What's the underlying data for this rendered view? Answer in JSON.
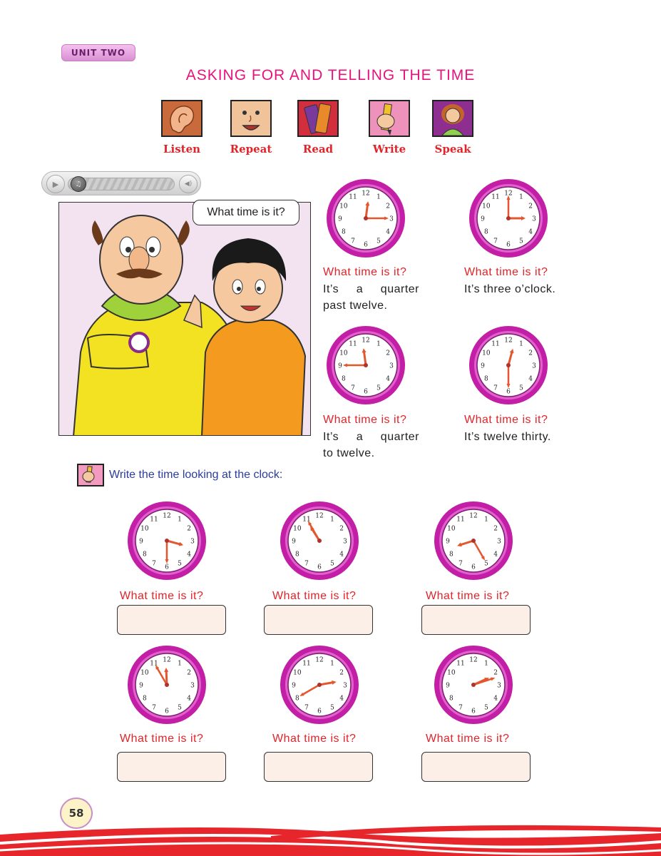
{
  "header": {
    "unit_label": "UNIT TWO",
    "title": "ASKING FOR AND TELLING THE TIME"
  },
  "skills": [
    {
      "label": "Listen",
      "icon": "ear-icon"
    },
    {
      "label": "Repeat",
      "icon": "talking-face-icon"
    },
    {
      "label": "Read",
      "icon": "books-icon"
    },
    {
      "label": "Write",
      "icon": "pencil-hand-icon"
    },
    {
      "label": "Speak",
      "icon": "girl-speaking-icon"
    }
  ],
  "audio_player": {
    "play_icon": "▶",
    "knob_icon": "♫",
    "volume_icon": "◀)"
  },
  "dialogue": {
    "bubble": "What time is it?"
  },
  "examples": [
    {
      "question": "What time is it?",
      "answer_line1": "It’s a quarter",
      "answer_line2": "past twelve.",
      "time": "12:15"
    },
    {
      "question": "What time is it?",
      "answer_line1": "It’s three o’clock.",
      "answer_line2": "",
      "time": "3:00"
    },
    {
      "question": "What time is it?",
      "answer_line1": "It’s a quarter",
      "answer_line2": "to twelve.",
      "time": "11:45"
    },
    {
      "question": "What time is it?",
      "answer_line1": "It’s twelve thirty.",
      "answer_line2": "",
      "time": "12:30"
    }
  ],
  "exercise": {
    "instruction": "Write the time looking at the clock:",
    "items": [
      {
        "question": "What time is it?",
        "time": "3:30"
      },
      {
        "question": "What time is it?",
        "time": "10:55"
      },
      {
        "question": "What time is it?",
        "time": "8:25"
      },
      {
        "question": "What time is it?",
        "time": "11:55"
      },
      {
        "question": "What time is it?",
        "time": "2:40"
      },
      {
        "question": "What time is it?",
        "time": "2:12"
      }
    ]
  },
  "page_number": "58",
  "colors": {
    "accent_pink": "#e6137a",
    "question_red": "#e1242a",
    "clock_rim": "#b0199b",
    "instruction_blue": "#2a3d9c"
  }
}
